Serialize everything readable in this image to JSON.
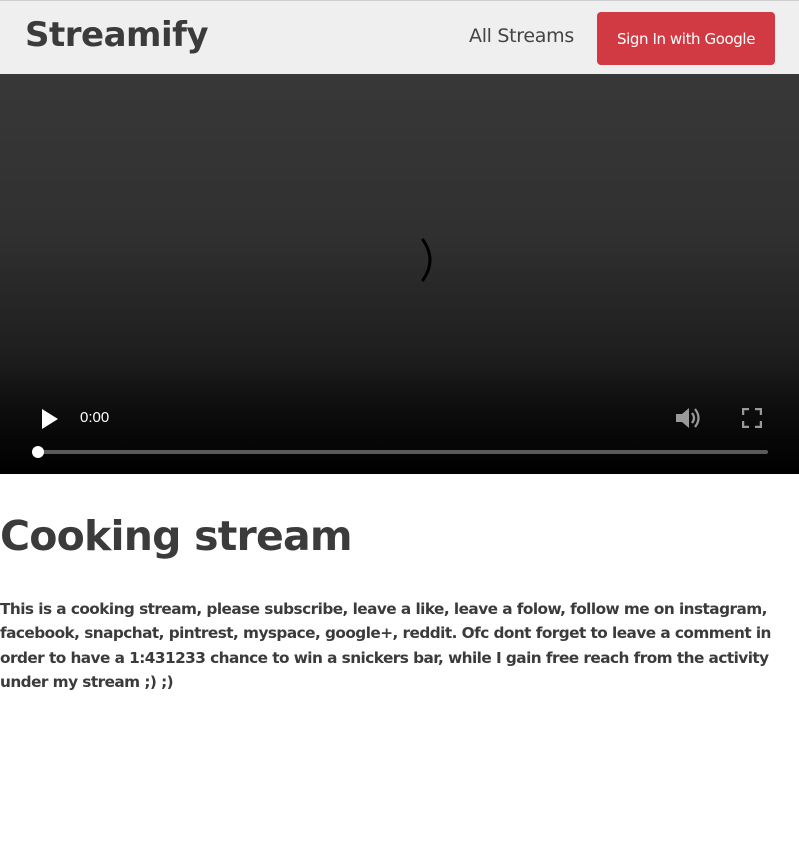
{
  "header": {
    "brand": "Streamify",
    "nav_all_streams": "All Streams",
    "signin_label": "Sign In with Google",
    "signin_color": "#d13a42"
  },
  "player": {
    "current_time": "0:00",
    "progress_fraction": 0.0,
    "icons": [
      "loading-spinner-icon",
      "play-icon",
      "volume-icon",
      "fullscreen-icon"
    ]
  },
  "stream": {
    "title": "Cooking stream",
    "description": "This is a cooking stream, please subscribe, leave a like, leave a folow, follow me on instagram, facebook, snapchat, pintrest, myspace, google+, reddit. Ofc dont forget to leave a comment in order to have a 1:431233 chance to win a snickers bar, while I gain free reach from the activity under my stream ;) ;)"
  }
}
